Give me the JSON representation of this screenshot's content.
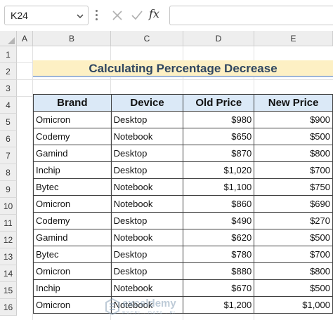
{
  "formula_bar": {
    "name_box": "K24",
    "fx_label": "fx",
    "formula": ""
  },
  "columns": [
    "A",
    "B",
    "C",
    "D",
    "E"
  ],
  "rows": [
    "1",
    "2",
    "3",
    "4",
    "5",
    "6",
    "7",
    "8",
    "9",
    "10",
    "11",
    "12",
    "13",
    "14",
    "15",
    "16"
  ],
  "sheet": {
    "title": "Calculating Percentage Decrease",
    "headers": [
      "Brand",
      "Device",
      "Old Price",
      "New Price"
    ],
    "records": [
      [
        "Omicron",
        "Desktop",
        "$980",
        "$900"
      ],
      [
        "Codemy",
        "Notebook",
        "$650",
        "$500"
      ],
      [
        "Gamind",
        "Desktop",
        "$870",
        "$800"
      ],
      [
        "Inchip",
        "Desktop",
        "$1,020",
        "$700"
      ],
      [
        "Bytec",
        "Notebook",
        "$1,100",
        "$750"
      ],
      [
        "Omicron",
        "Notebook",
        "$860",
        "$690"
      ],
      [
        "Codemy",
        "Desktop",
        "$490",
        "$270"
      ],
      [
        "Gamind",
        "Notebook",
        "$620",
        "$500"
      ],
      [
        "Bytec",
        "Desktop",
        "$780",
        "$700"
      ],
      [
        "Omicron",
        "Desktop",
        "$880",
        "$800"
      ],
      [
        "Inchip",
        "Notebook",
        "$670",
        "$500"
      ],
      [
        "Omicron",
        "Notebook",
        "$1,200",
        "$1,000"
      ]
    ]
  },
  "watermark": {
    "name": "exceldemy",
    "tagline": "EXCEL · DATA · BI"
  },
  "colors": {
    "title_fill": "#fdf0c4",
    "header_fill": "#dbe9f7",
    "title_text": "#2f4660"
  }
}
